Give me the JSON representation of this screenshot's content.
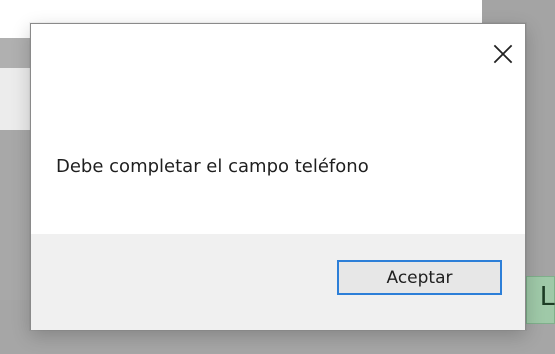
{
  "background": {
    "edge_button_text": "L",
    "edge_button_color": "#9fc9a8"
  },
  "dialog": {
    "message": "Debe completar el campo teléfono",
    "close_icon": "close-icon",
    "accept_label": "Aceptar",
    "accent_color": "#2d7fd8"
  }
}
